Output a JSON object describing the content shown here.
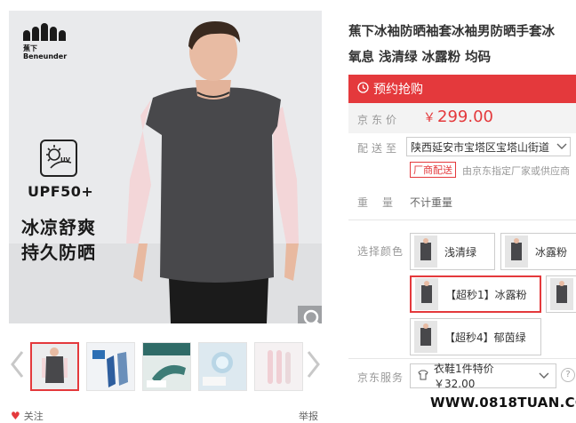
{
  "brand": {
    "cn": "蕉下",
    "en": "Beneunder"
  },
  "hero": {
    "upf_label": "UPF50+",
    "uv_label": "UV",
    "slogan_line1": "冰凉舒爽",
    "slogan_line2": "持久防晒"
  },
  "gallery": {
    "thumbnails": [
      {
        "name": "thumb-1",
        "active": true
      },
      {
        "name": "thumb-2",
        "active": false
      },
      {
        "name": "thumb-3",
        "active": false
      },
      {
        "name": "thumb-4",
        "active": false
      },
      {
        "name": "thumb-5",
        "active": false
      }
    ]
  },
  "footer": {
    "follow_label": "关注",
    "report_label": "举报"
  },
  "product": {
    "title_line1": "蕉下冰袖防晒袖套冰袖男防晒手套冰",
    "title_line2": "氧息 浅清绿 冰露粉 均码",
    "presale_label": "预约抢购",
    "price_label": "京东价",
    "currency": "￥",
    "price": "299.00",
    "ship_label": "配送至",
    "address": "陕西延安市宝塔区宝塔山街道",
    "factory_badge": "厂商配送",
    "factory_note": "由京东指定厂家或供应商",
    "weight_label": "重量",
    "weight_value": "不计重量",
    "color_label": "选择颜色",
    "colors": [
      "浅清绿",
      "冰露粉",
      "【超秒1】冰露粉",
      "【超秒4】郁茵绿"
    ],
    "service_label": "京东服务",
    "service_value": "衣鞋1件特价 ￥32.00"
  },
  "watermark": "WWW.0818TUAN.COM",
  "colors": {
    "accent": "#e4393c",
    "price_bg": "#f3f3f3"
  }
}
